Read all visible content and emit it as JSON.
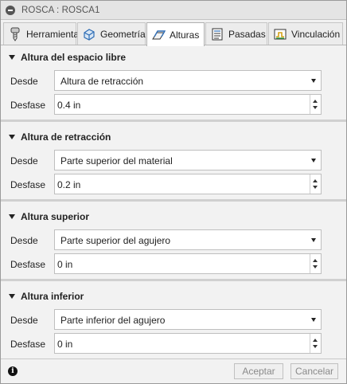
{
  "window": {
    "title": "ROSCA : ROSCA1"
  },
  "tabs": [
    {
      "label": "Herramienta",
      "icon": "tool-icon"
    },
    {
      "label": "Geometría",
      "icon": "geometry-icon"
    },
    {
      "label": "Alturas",
      "icon": "heights-icon",
      "active": true
    },
    {
      "label": "Pasadas",
      "icon": "passes-icon"
    },
    {
      "label": "Vinculación",
      "icon": "linking-icon"
    }
  ],
  "groups": [
    {
      "title": "Altura del espacio libre",
      "from_label": "Desde",
      "from_value": "Altura de retracción",
      "offset_label": "Desfase",
      "offset_value": "0.4 in"
    },
    {
      "title": "Altura de retracción",
      "from_label": "Desde",
      "from_value": "Parte superior del material",
      "offset_label": "Desfase",
      "offset_value": "0.2 in"
    },
    {
      "title": "Altura superior",
      "from_label": "Desde",
      "from_value": "Parte superior del agujero",
      "offset_label": "Desfase",
      "offset_value": "0 in"
    },
    {
      "title": "Altura inferior",
      "from_label": "Desde",
      "from_value": "Parte inferior del agujero",
      "offset_label": "Desfase",
      "offset_value": "0 in"
    }
  ],
  "footer": {
    "ok_label": "Aceptar",
    "cancel_label": "Cancelar"
  },
  "colors": {
    "accent_blue": "#2f6db5",
    "tab_active_bg": "#ffffff",
    "button_text_disabled": "#8a8a8a"
  }
}
